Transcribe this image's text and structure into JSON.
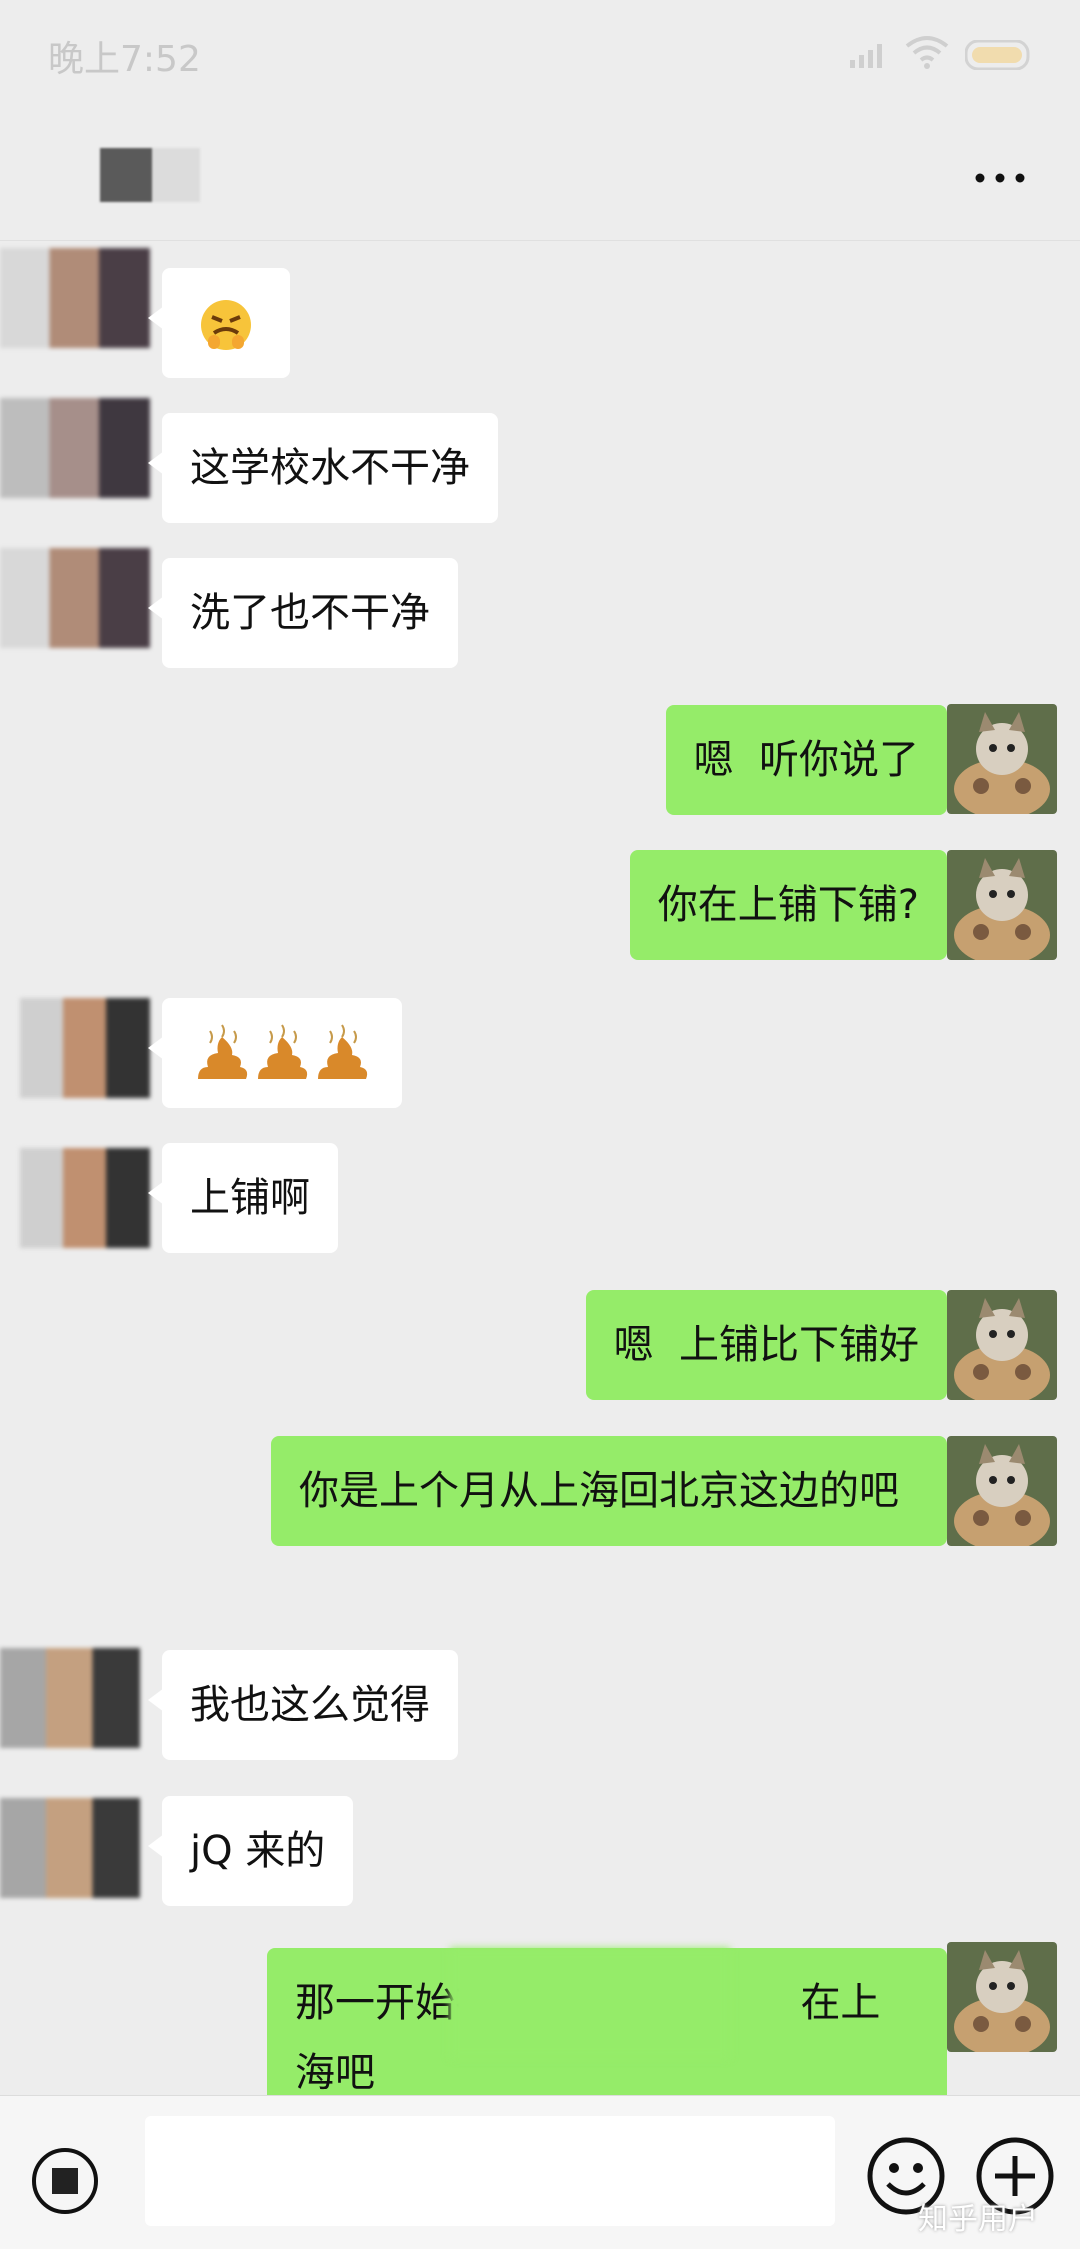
{
  "status": {
    "time": "晚上7:52"
  },
  "header": {
    "more_icon": "more-dots-icon"
  },
  "messages": [
    {
      "side": "left",
      "type": "emoji",
      "icon": "grimace-emoji-icon"
    },
    {
      "side": "left",
      "text": "这学校水不干净"
    },
    {
      "side": "left",
      "text": "洗了也不干净"
    },
    {
      "side": "right",
      "text": "嗯  听你说了"
    },
    {
      "side": "right",
      "text": "你在上铺下铺?"
    },
    {
      "side": "left",
      "type": "emoji",
      "icon": "poop-emoji-icon"
    },
    {
      "side": "left",
      "text": "上铺啊"
    },
    {
      "side": "right",
      "text": "嗯  上铺比下铺好"
    },
    {
      "side": "right",
      "text": "你是上个月从上海回北京这边的吧"
    },
    {
      "side": "left",
      "text": "我也这么觉得"
    },
    {
      "side": "left",
      "text": "jQ 来的"
    },
    {
      "side": "right",
      "text_start": "那一开始在",
      "text_end": "在上海吧"
    }
  ],
  "input": {
    "watermark": "知乎用户"
  },
  "colors": {
    "bubble_right": "#95ec69",
    "bubble_left": "#ffffff",
    "background": "#ededed"
  }
}
